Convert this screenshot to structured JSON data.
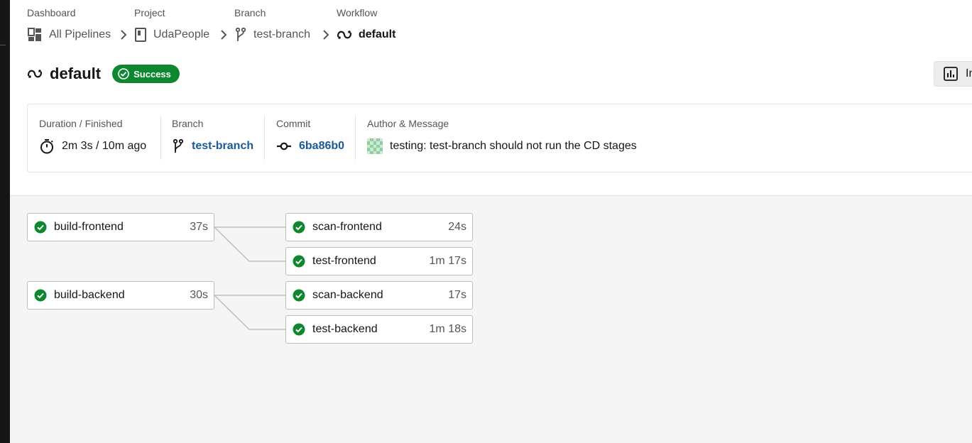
{
  "breadcrumb": {
    "dashboard": {
      "label": "Dashboard",
      "value": "All Pipelines"
    },
    "project": {
      "label": "Project",
      "value": "UdaPeople"
    },
    "branch": {
      "label": "Branch",
      "value": "test-branch"
    },
    "workflow": {
      "label": "Workflow",
      "value": "default"
    }
  },
  "header": {
    "title": "default",
    "status": "Success",
    "insights_label": "In"
  },
  "info": {
    "duration_label": "Duration / Finished",
    "duration_value": "2m 3s / 10m ago",
    "branch_label": "Branch",
    "branch_value": "test-branch",
    "commit_label": "Commit",
    "commit_value": "6ba86b0",
    "author_label": "Author & Message",
    "author_message": "testing: test-branch should not run the CD stages"
  },
  "jobs": {
    "build_frontend": {
      "name": "build-frontend",
      "duration": "37s",
      "status": "success"
    },
    "scan_frontend": {
      "name": "scan-frontend",
      "duration": "24s",
      "status": "success"
    },
    "test_frontend": {
      "name": "test-frontend",
      "duration": "1m 17s",
      "status": "success"
    },
    "build_backend": {
      "name": "build-backend",
      "duration": "30s",
      "status": "success"
    },
    "scan_backend": {
      "name": "scan-backend",
      "duration": "17s",
      "status": "success"
    },
    "test_backend": {
      "name": "test-backend",
      "duration": "1m 18s",
      "status": "success"
    }
  },
  "colors": {
    "success": "#0d8730",
    "link": "#1a5a96",
    "text": "#161616",
    "muted": "#555555"
  }
}
